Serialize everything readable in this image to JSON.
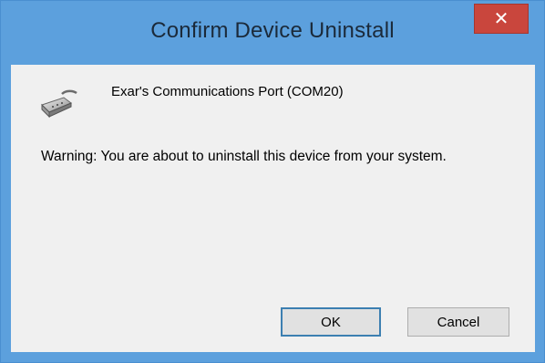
{
  "window": {
    "title": "Confirm Device Uninstall",
    "close_label": "✕"
  },
  "device": {
    "name": "Exar's Communications Port (COM20)",
    "icon": "serial-port-icon"
  },
  "message": {
    "warning": "Warning: You are about to uninstall this device from your system."
  },
  "buttons": {
    "ok_label": "OK",
    "cancel_label": "Cancel"
  },
  "colors": {
    "frame": "#5ca0dd",
    "client": "#f0f0f0",
    "close": "#c9463d",
    "default_button_border": "#3c7fb1"
  }
}
